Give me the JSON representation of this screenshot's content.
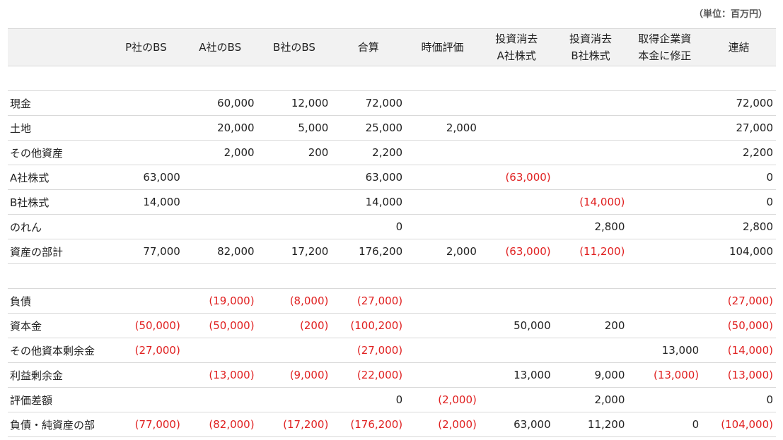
{
  "unit_label": "（単位：百万円）",
  "headers": {
    "label": "",
    "p_bs": "P社のBS",
    "a_bs": "A社のBS",
    "b_bs": "B社のBS",
    "total": "合算",
    "fair_value": "時価評価",
    "elim_a_line1": "投資消去",
    "elim_a_line2": "A社株式",
    "elim_b_line1": "投資消去",
    "elim_b_line2": "B社株式",
    "acq_line1": "取得企業資",
    "acq_line2": "本金に修正",
    "consolidated": "連結"
  },
  "assets": [
    {
      "label": "現金",
      "values": [
        "",
        "60,000",
        "12,000",
        "72,000",
        "",
        "",
        "",
        "",
        "72,000"
      ]
    },
    {
      "label": "土地",
      "values": [
        "",
        "20,000",
        "5,000",
        "25,000",
        "2,000",
        "",
        "",
        "",
        "27,000"
      ]
    },
    {
      "label": "その他資産",
      "values": [
        "",
        "2,000",
        "200",
        "2,200",
        "",
        "",
        "",
        "",
        "2,200"
      ]
    },
    {
      "label": "A社株式",
      "values": [
        "63,000",
        "",
        "",
        "63,000",
        "",
        "(63,000)",
        "",
        "",
        "0"
      ]
    },
    {
      "label": "B社株式",
      "values": [
        "14,000",
        "",
        "",
        "14,000",
        "",
        "",
        "(14,000)",
        "",
        "0"
      ]
    },
    {
      "label": "のれん",
      "values": [
        "",
        "",
        "",
        "0",
        "",
        "",
        "2,800",
        "",
        "2,800"
      ]
    },
    {
      "label": "資産の部計",
      "values": [
        "77,000",
        "82,000",
        "17,200",
        "176,200",
        "2,000",
        "(63,000)",
        "(11,200)",
        "",
        "104,000"
      ]
    }
  ],
  "liabilities": [
    {
      "label": "負債",
      "values": [
        "",
        "(19,000)",
        "(8,000)",
        "(27,000)",
        "",
        "",
        "",
        "",
        "(27,000)"
      ]
    },
    {
      "label": "資本金",
      "values": [
        "(50,000)",
        "(50,000)",
        "(200)",
        "(100,200)",
        "",
        "50,000",
        "200",
        "",
        "(50,000)"
      ]
    },
    {
      "label": "その他資本剰余金",
      "values": [
        "(27,000)",
        "",
        "",
        "(27,000)",
        "",
        "",
        "",
        "13,000",
        "(14,000)"
      ]
    },
    {
      "label": "利益剰余金",
      "values": [
        "",
        "(13,000)",
        "(9,000)",
        "(22,000)",
        "",
        "13,000",
        "9,000",
        "(13,000)",
        "(13,000)"
      ]
    },
    {
      "label": "評価差額",
      "values": [
        "",
        "",
        "",
        "0",
        "(2,000)",
        "",
        "2,000",
        "",
        "0"
      ]
    },
    {
      "label": "負債・純資産の部",
      "values": [
        "(77,000)",
        "(82,000)",
        "(17,200)",
        "(176,200)",
        "(2,000)",
        "63,000",
        "11,200",
        "0",
        "(104,000)"
      ]
    }
  ],
  "colors": {
    "negative": "#e02020",
    "header_bg": "#f2f2f2",
    "rule": "#d9d9d9"
  }
}
